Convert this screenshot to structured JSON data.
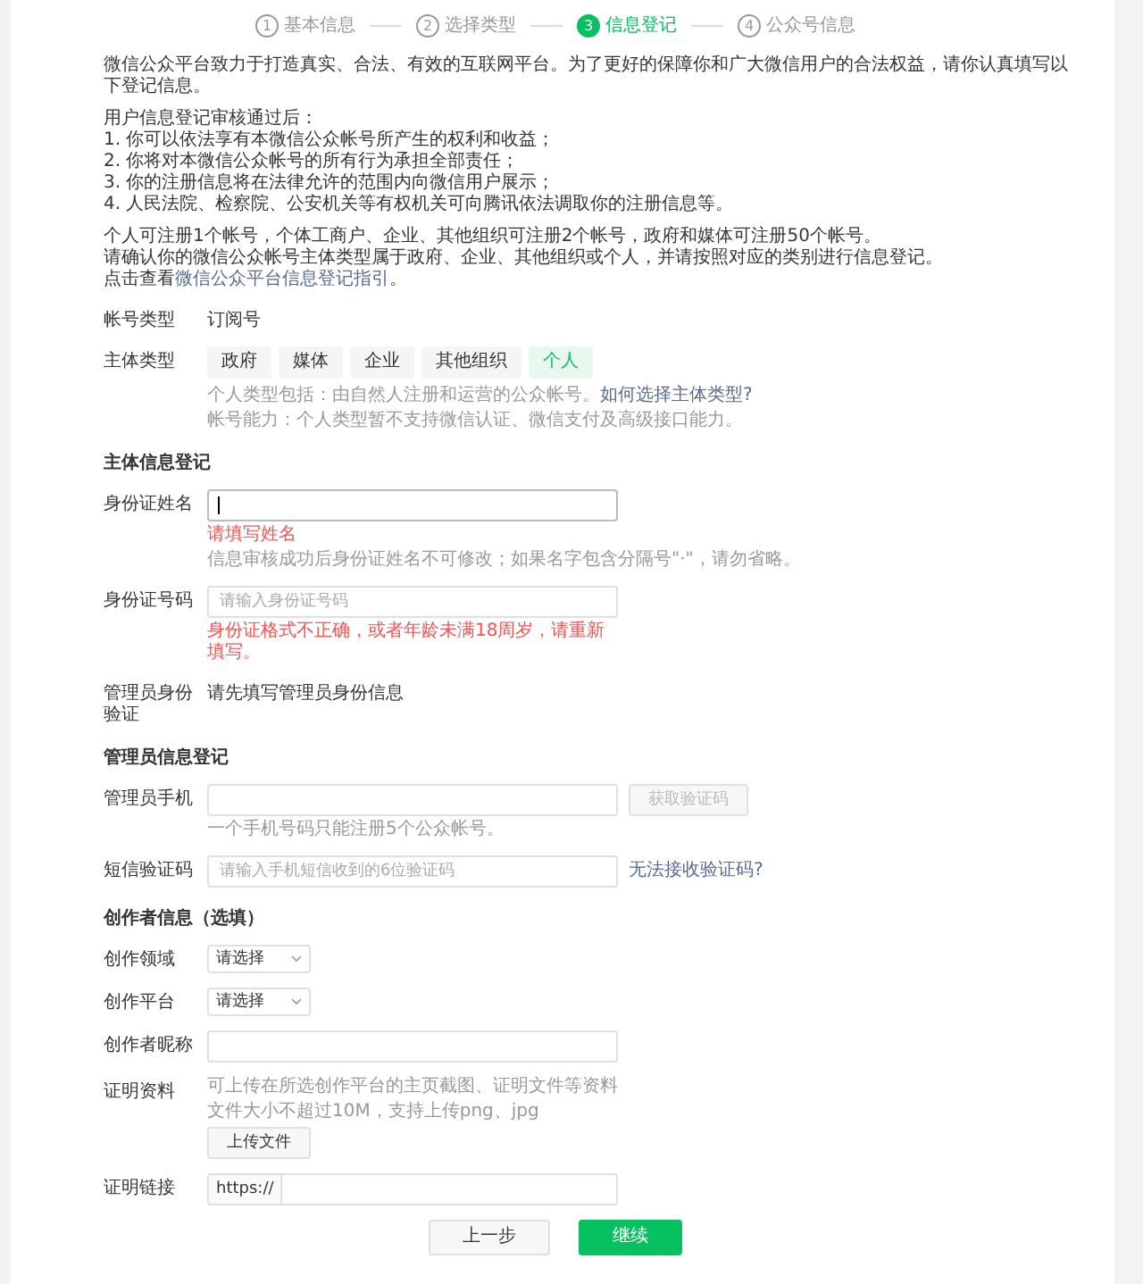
{
  "steps": [
    {
      "number": "1",
      "label": "基本信息",
      "selected": false
    },
    {
      "number": "2",
      "label": "选择类型",
      "selected": false
    },
    {
      "number": "3",
      "label": "信息登记",
      "selected": true
    },
    {
      "number": "4",
      "label": "公众号信息",
      "selected": false
    }
  ],
  "intro": {
    "lead": "微信公众平台致力于打造真实、合法、有效的互联网平台。为了更好的保障你和广大微信用户的合法权益，请你认真填写以下登记信息。",
    "list_title": "用户信息登记审核通过后：",
    "list": [
      "1. 你可以依法享有本微信公众帐号所产生的权利和收益；",
      "2. 你将对本微信公众帐号的所有行为承担全部责任；",
      "3. 你的注册信息将在法律允许的范围内向微信用户展示；",
      "4. 人民法院、检察院、公安机关等有权机关可向腾讯依法调取你的注册信息等。"
    ],
    "rules": [
      "个人可注册1个帐号，个体工商户、企业、其他组织可注册2个帐号，政府和媒体可注册50个帐号。",
      "请确认你的微信公众帐号主体类型属于政府、企业、其他组织或个人，并请按照对应的类别进行信息登记。"
    ],
    "guide_prefix": "点击查看",
    "guide_link": "微信公众平台信息登记指引",
    "guide_suffix": "。"
  },
  "account_type": {
    "label": "帐号类型",
    "value": "订阅号"
  },
  "subject_type": {
    "label": "主体类型",
    "options": [
      {
        "label": "政府",
        "selected": false
      },
      {
        "label": "媒体",
        "selected": false
      },
      {
        "label": "企业",
        "selected": false
      },
      {
        "label": "其他组织",
        "selected": false
      },
      {
        "label": "个人",
        "selected": true
      }
    ],
    "help": "个人类型包括：由自然人注册和运营的公众帐号。",
    "help_link": "如何选择主体类型?",
    "ability": "帐号能力：个人类型暂不支持微信认证、微信支付及高级接口能力。"
  },
  "sections": [
    {
      "title": "主体信息登记",
      "rows": [
        {
          "kind": "input",
          "label": "身份证姓名",
          "focused": true,
          "error": "请填写姓名",
          "hint": "信息审核成功后身份证姓名不可修改；如果名字包含分隔号\"·\"，请勿省略。"
        },
        {
          "kind": "input",
          "label": "身份证号码",
          "placeholder": "请输入身份证号码",
          "focused": false,
          "error": "身份证格式不正确，或者年龄未满18周岁，请重新填写。"
        },
        {
          "kind": "text",
          "label": "管理员身份验证",
          "value": "请先填写管理员身份信息"
        }
      ]
    },
    {
      "title": "管理员信息登记",
      "rows": [
        {
          "kind": "input",
          "label": "管理员手机",
          "focused": false,
          "button": "获取验证码",
          "hint": "一个手机号码只能注册5个公众帐号。"
        },
        {
          "kind": "input",
          "label": "短信验证码",
          "placeholder": "请输入手机短信收到的6位验证码",
          "focused": false,
          "link": "无法接收验证码?"
        }
      ]
    },
    {
      "title": "创作者信息（选填）",
      "rows": [
        {
          "kind": "select",
          "label": "创作领域",
          "value": "请选择"
        },
        {
          "kind": "select",
          "label": "创作平台",
          "value": "请选择"
        },
        {
          "kind": "input",
          "label": "创作者昵称",
          "focused": false
        },
        {
          "kind": "upload",
          "label": "证明资料",
          "lines": [
            "可上传在所选创作平台的主页截图、证明文件等资料",
            "文件大小不超过10M，支持上传png、jpg"
          ],
          "button": "上传文件"
        },
        {
          "kind": "prefixed",
          "label": "证明链接",
          "prefix": "https://"
        }
      ]
    }
  ],
  "buttons": [
    {
      "label": "上一步",
      "primary": false
    },
    {
      "label": "继续",
      "primary": true
    }
  ]
}
